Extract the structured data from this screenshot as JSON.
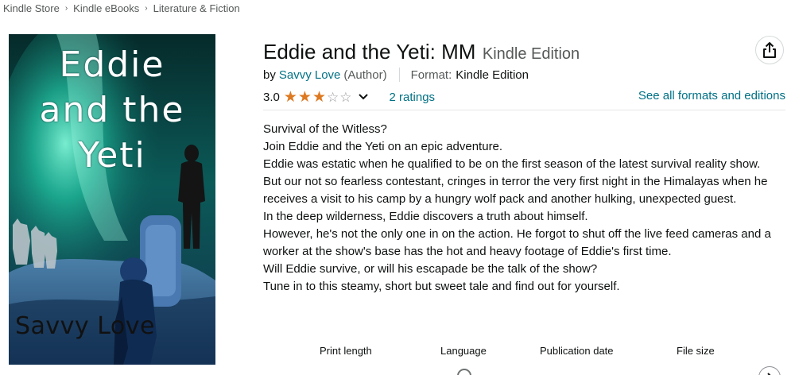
{
  "breadcrumb": [
    {
      "label": "Kindle Store"
    },
    {
      "label": "Kindle eBooks"
    },
    {
      "label": "Literature & Fiction"
    }
  ],
  "cover": {
    "title_text": "Eddie\nand the\nYeti",
    "author_text": "Savvy Love"
  },
  "product": {
    "title": "Eddie and the Yeti: MM",
    "edition": "Kindle Edition",
    "by_label": "by",
    "author": "Savvy Love",
    "author_role": "(Author)",
    "format_label": "Format:",
    "format_value": "Kindle Edition",
    "rating_value": "3.0",
    "rating_stars": 3,
    "rating_max": 5,
    "ratings_count_label": "2 ratings",
    "see_all_label": "See all formats and editions"
  },
  "description": [
    "Survival of the Witless?",
    "Join Eddie and the Yeti on an epic adventure.",
    "Eddie was estatic when he qualified to be on the first season of the latest survival reality show.",
    "But our not so fearless contestant, cringes in terror the very first night in the Himalayas when he receives a visit to his camp by a hungry wolf pack and another hulking, unexpected guest.",
    "In the deep wilderness, Eddie discovers a truth about himself.",
    "However, he's not the only one in on the action. He forgot to shut off the live feed cameras and a worker at the show's base has the hot and heavy footage of Eddie's first time.",
    "Will Eddie survive, or will his escapade be the talk of the show?",
    "Tune in to this steamy, short but sweet tale and find out for yourself."
  ],
  "details": {
    "labels": [
      "Print length",
      "Language",
      "Publication date",
      "File size"
    ]
  },
  "icons": {
    "share": "share-icon",
    "chevron_down": "chevron-down-icon",
    "breadcrumb_separator": "chevron-right-icon",
    "carousel_next": "chevron-right-icon"
  },
  "colors": {
    "link": "#007185",
    "star": "#de7921",
    "muted_text": "#565959",
    "divider": "#d5d9d9"
  }
}
